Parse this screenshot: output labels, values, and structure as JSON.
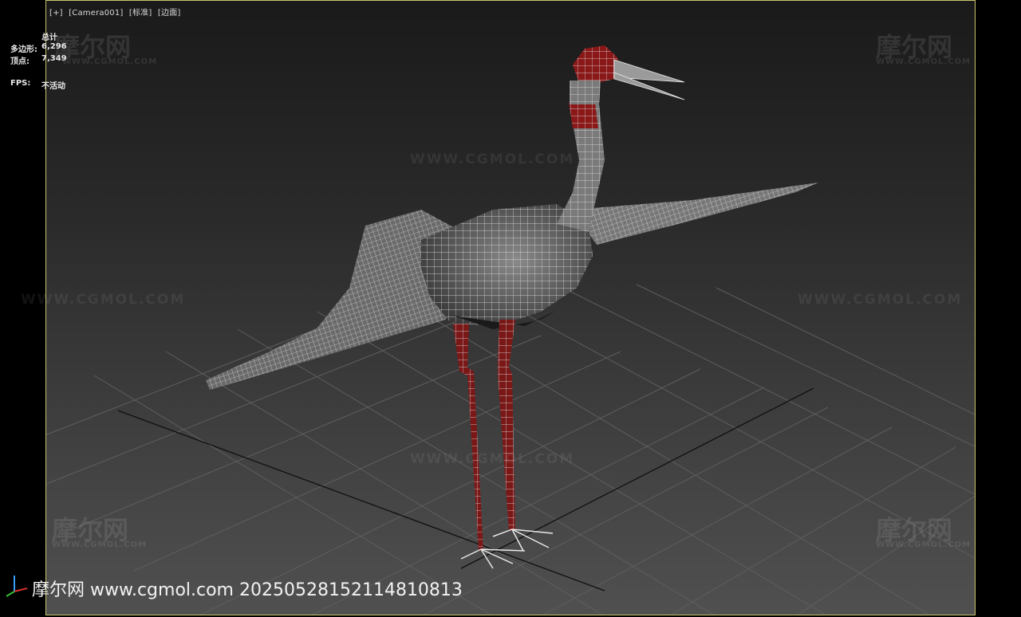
{
  "viewport": {
    "labels": [
      "[+]",
      "[Camera001]",
      "[标准]",
      "[边面]"
    ]
  },
  "stats": {
    "header": "总计",
    "polys_label": "多边形:",
    "polys_value": "6,296",
    "verts_label": "顶点:",
    "verts_value": "7,349",
    "fps_label": "FPS:",
    "fps_value": "不活动"
  },
  "watermarks": {
    "site_text": "WWW.CGMOL.COM",
    "logo_text": "摩尔网",
    "logo_sub": "WWW.CGMOL.COM"
  },
  "bottom_watermark": "摩尔网 www.cgmol.com 20250528152114810813",
  "colors": {
    "viewport_border": "#c8c26a",
    "wire": "#e8e8e8",
    "red_region": "#8a1818"
  },
  "icons": {
    "axis": "axis-gizmo-icon"
  }
}
